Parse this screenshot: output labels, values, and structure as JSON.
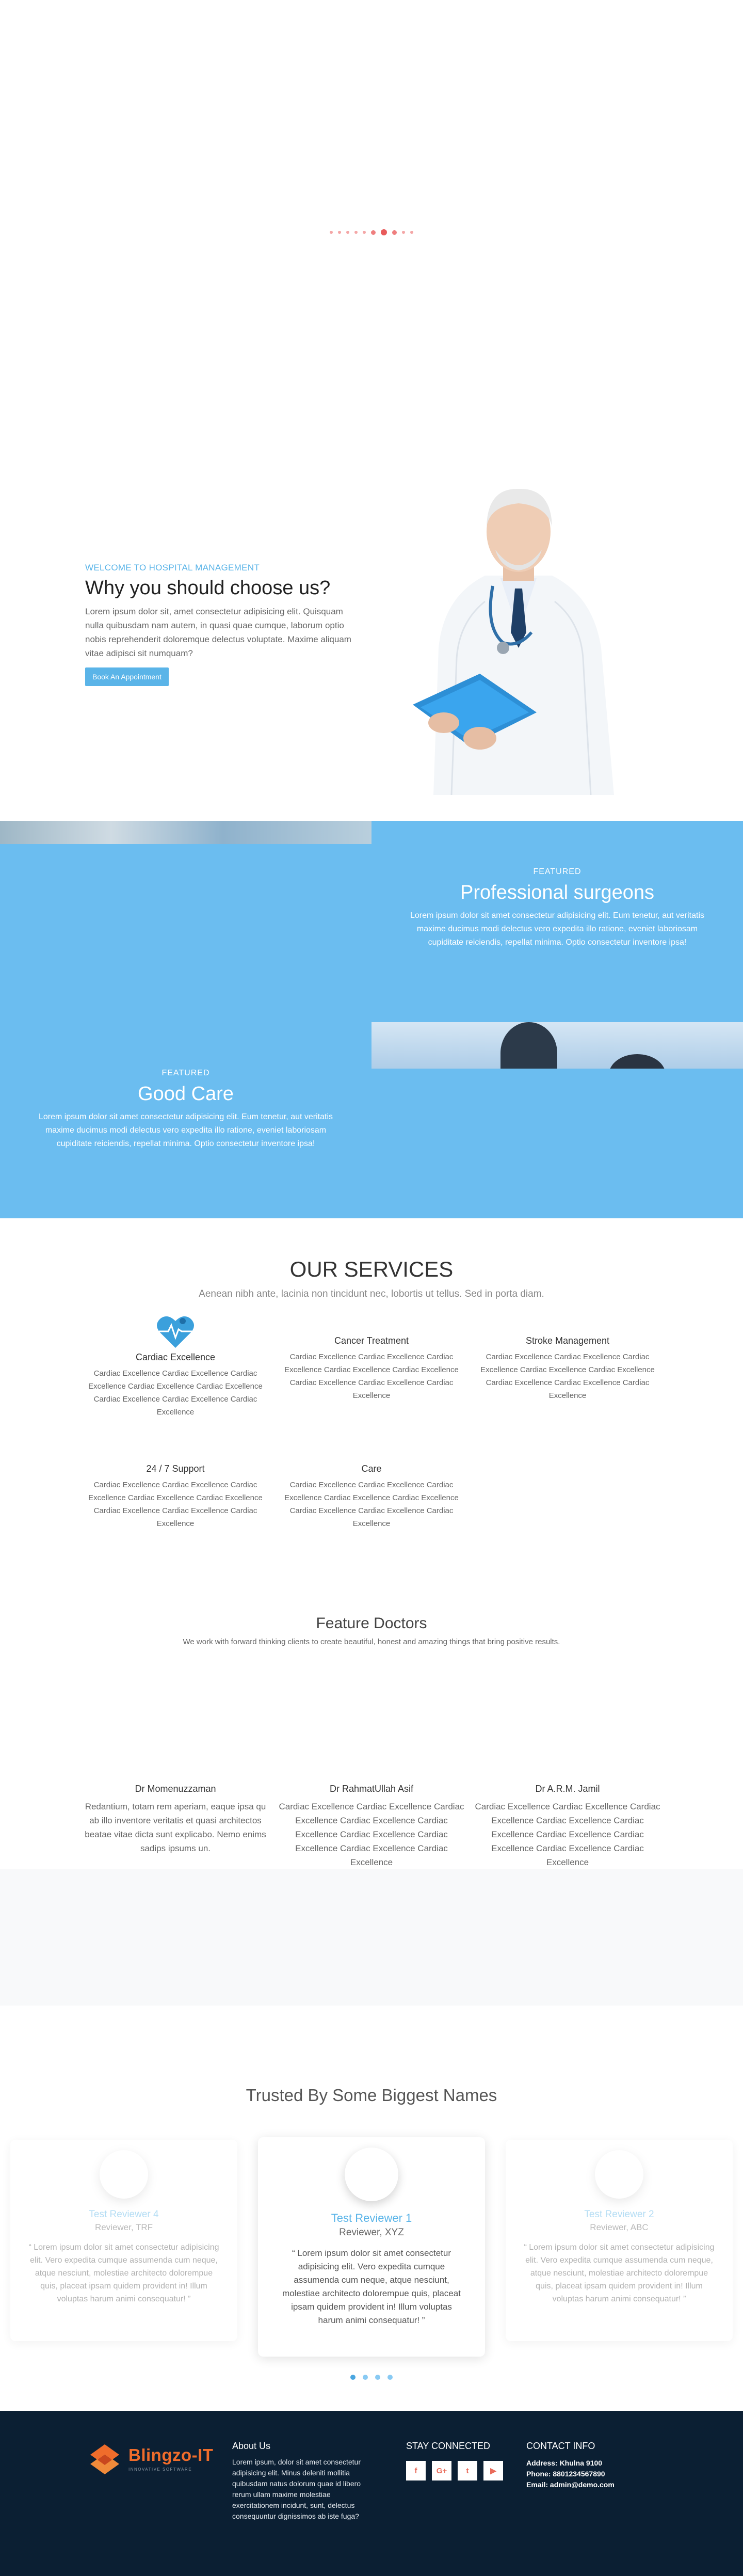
{
  "slider": {
    "dot_count": 10,
    "active_index": 6
  },
  "why": {
    "kicker": "WELCOME TO HOSPITAL MANAGEMENT",
    "title": "Why you should choose us?",
    "text": "Lorem ipsum dolor sit, amet consectetur adipisicing elit. Quisquam nulla quibusdam nam autem, in quasi quae cumque, laborum optio nobis reprehenderit doloremque delectus voluptate. Maxime aliquam vitae adipisci sit numquam?",
    "button": "Book An Appointment"
  },
  "featured": [
    {
      "kicker": "FEATURED",
      "title": "Professional surgeons",
      "text": "Lorem ipsum dolor sit amet consectetur adipisicing elit. Eum tenetur, aut veritatis maxime ducimus modi delectus vero expedita illo ratione, eveniet laboriosam cupiditate reiciendis, repellat minima. Optio consectetur inventore ipsa!"
    },
    {
      "kicker": "FEATURED",
      "title": "Good Care",
      "text": "Lorem ipsum dolor sit amet consectetur adipisicing elit. Eum tenetur, aut veritatis maxime ducimus modi delectus vero expedita illo ratione, eveniet laboriosam cupiditate reiciendis, repellat minima. Optio consectetur inventore ipsa!"
    }
  ],
  "services": {
    "title": "OUR SERVICES",
    "subtitle": "Aenean nibh ante, lacinia non tincidunt nec, lobortis ut tellus. Sed in porta diam.",
    "items": [
      {
        "title": "Cardiac Excellence",
        "text": "Cardiac Excellence Cardiac Excellence Cardiac Excellence Cardiac Excellence Cardiac Excellence Cardiac Excellence Cardiac Excellence Cardiac Excellence"
      },
      {
        "title": "Cancer Treatment",
        "text": "Cardiac Excellence Cardiac Excellence Cardiac Excellence Cardiac Excellence Cardiac Excellence Cardiac Excellence Cardiac Excellence Cardiac Excellence"
      },
      {
        "title": "Stroke Management",
        "text": "Cardiac Excellence Cardiac Excellence Cardiac Excellence Cardiac Excellence Cardiac Excellence Cardiac Excellence Cardiac Excellence Cardiac Excellence"
      },
      {
        "title": "24 / 7 Support",
        "text": "Cardiac Excellence Cardiac Excellence Cardiac Excellence Cardiac Excellence Cardiac Excellence Cardiac Excellence Cardiac Excellence Cardiac Excellence"
      },
      {
        "title": "Care",
        "text": "Cardiac Excellence Cardiac Excellence Cardiac Excellence Cardiac Excellence Cardiac Excellence Cardiac Excellence Cardiac Excellence Cardiac Excellence"
      }
    ]
  },
  "feature_doctors": {
    "title": "Feature Doctors",
    "subtitle": "We work with forward thinking clients to create beautiful, honest and amazing things that bring positive results.",
    "doctors": [
      {
        "name": "Dr Momenuzzaman",
        "text": "Redantium, totam rem aperiam, eaque ipsa qu ab illo inventore veritatis et quasi architectos beatae vitae dicta sunt explicabo. Nemo enims sadips ipsums un."
      },
      {
        "name": "Dr RahmatUllah Asif",
        "text": "Cardiac Excellence Cardiac Excellence Cardiac Excellence Cardiac Excellence Cardiac Excellence Cardiac Excellence Cardiac Excellence Cardiac Excellence Cardiac Excellence"
      },
      {
        "name": "Dr A.R.M. Jamil",
        "text": "Cardiac Excellence Cardiac Excellence Cardiac Excellence Cardiac Excellence Cardiac Excellence Cardiac Excellence Cardiac Excellence Cardiac Excellence Cardiac Excellence"
      }
    ]
  },
  "testimonials": {
    "title": "Trusted By Some Biggest Names",
    "cards": [
      {
        "name": "Test Reviewer 4",
        "role": "Reviewer, TRF",
        "quote": "“ Lorem ipsum dolor sit amet consectetur adipisicing elit. Vero expedita cumque assumenda cum neque, atque nesciunt, molestiae architecto dolorempue quis, placeat ipsam quidem provident in! Illum voluptas harum animi consequatur! ”"
      },
      {
        "name": "Test Reviewer 1",
        "role": "Reviewer, XYZ",
        "quote": "“ Lorem ipsum dolor sit amet consectetur adipisicing elit. Vero expedita cumque assumenda cum neque, atque nesciunt, molestiae architecto dolorempue quis, placeat ipsam quidem provident in! Illum voluptas harum animi consequatur! ”"
      },
      {
        "name": "Test Reviewer 2",
        "role": "Reviewer, ABC",
        "quote": "“ Lorem ipsum dolor sit amet consectetur adipisicing elit. Vero expedita cumque assumenda cum neque, atque nesciunt, molestiae architecto dolorempue quis, placeat ipsam quidem provident in! Illum voluptas harum animi consequatur! ”"
      }
    ],
    "dot_count": 4,
    "active_dot": 0
  },
  "footer": {
    "brand": "Blingzo-IT",
    "tagline": "INNOVATIVE SOFTWARE",
    "about_title": "About Us",
    "about_text": "Lorem ipsum, dolor sit amet consectetur adipisicing elit. Minus deleniti mollitia quibusdam natus dolorum quae id libero rerum ullam maxime molestiae exercitationem incidunt, sunt, delectus consequuntur dignissimos ab iste fuga?",
    "social_title": "STAY CONNECTED",
    "social": [
      "f",
      "G+",
      "t",
      "▶"
    ],
    "contact_title": "CONTACT INFO",
    "address": "Address: Khulna 9100",
    "phone": "Phone: 8801234567890",
    "email": "Email: admin@demo.com"
  },
  "colors": {
    "accent": "#5ab4e8",
    "blue_section": "#6bbdf0",
    "footer_bg": "#0b1f33",
    "brand_orange": "#ef6c2b",
    "slider_dot": "#e85b5b"
  }
}
